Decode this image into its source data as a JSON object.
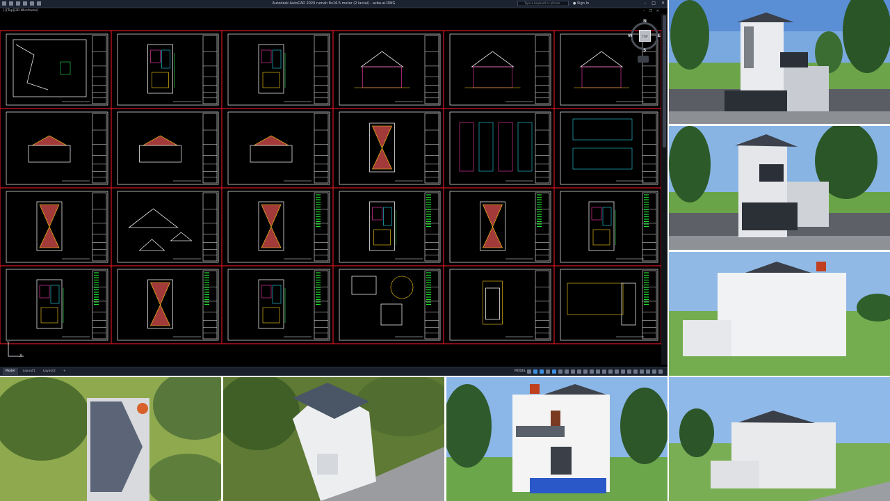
{
  "app": {
    "title": "Autodesk AutoCAD 2020    rumah 8x16.5 meter (2 lantai) - acbe.ai.DWG",
    "search_placeholder": "Type a keyword or phrase",
    "sign_in_label": "Sign In",
    "viewport_label": "[-][Top][2D Wireframe]"
  },
  "navcube": {
    "north": "N",
    "south": "S",
    "west": "W",
    "east": "E",
    "face": "TOP"
  },
  "coordinates": {
    "x_label": "X",
    "y_label": "Y"
  },
  "layout_tabs": [
    {
      "label": "Model",
      "active": true
    },
    {
      "label": "Layout1",
      "active": false
    },
    {
      "label": "Layout2",
      "active": false
    },
    {
      "label": "+",
      "active": false
    }
  ],
  "status": {
    "mode_label": "MODEL"
  },
  "icons": {
    "search": "search-icon",
    "user": "user-icon",
    "minimize": "minimize-icon",
    "maximize": "maximize-icon",
    "close": "close-icon"
  },
  "colors": {
    "frame_red": "#d01623",
    "legend_green": "#20e030",
    "accent_magenta": "#ff3fb4",
    "accent_yellow": "#ffd21a",
    "accent_cyan": "#28d8e8"
  }
}
